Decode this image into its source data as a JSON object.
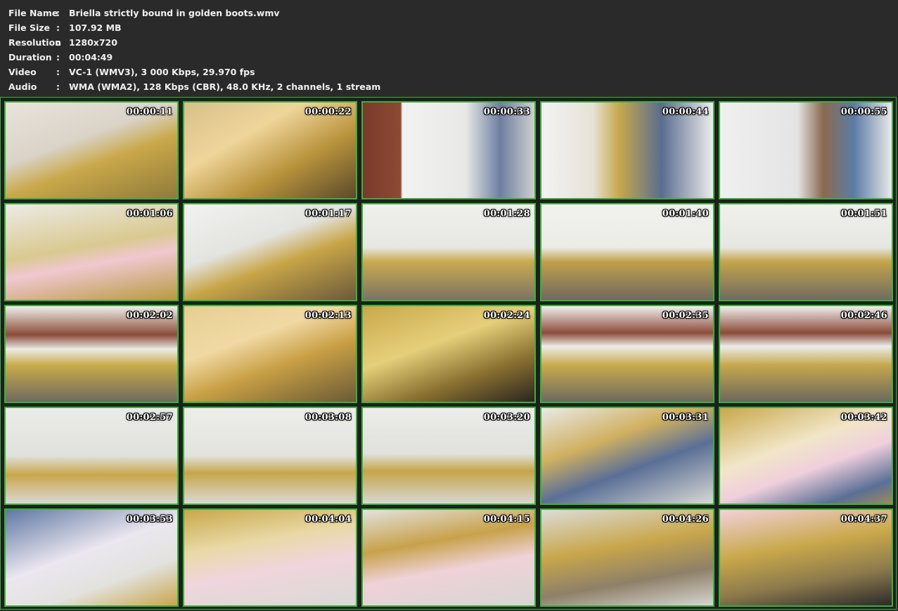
{
  "info": [
    {
      "key": "File Name",
      "value": "Briella strictly bound in golden boots.wmv"
    },
    {
      "key": "File Size",
      "value": "107.92 MB"
    },
    {
      "key": "Resolution",
      "value": "1280x720"
    },
    {
      "key": "Duration",
      "value": "00:04:49"
    },
    {
      "key": "Video",
      "value": "VC-1 (WMV3), 3 000 Kbps, 29.970 fps"
    },
    {
      "key": "Audio",
      "value": "WMA (WMA2), 128 Kbps (CBR), 48.0 KHz, 2 channels, 1 stream"
    }
  ],
  "separator": ":",
  "colors": {
    "background": "#2a2a2a",
    "frame_border": "#37b237",
    "text": "#f0f0f0"
  },
  "thumbnails": [
    {
      "time": "00:00:11"
    },
    {
      "time": "00:00:22"
    },
    {
      "time": "00:00:33"
    },
    {
      "time": "00:00:44"
    },
    {
      "time": "00:00:55"
    },
    {
      "time": "00:01:06"
    },
    {
      "time": "00:01:17"
    },
    {
      "time": "00:01:28"
    },
    {
      "time": "00:01:40"
    },
    {
      "time": "00:01:51"
    },
    {
      "time": "00:02:02"
    },
    {
      "time": "00:02:13"
    },
    {
      "time": "00:02:24"
    },
    {
      "time": "00:02:35"
    },
    {
      "time": "00:02:46"
    },
    {
      "time": "00:02:57"
    },
    {
      "time": "00:03:08"
    },
    {
      "time": "00:03:20"
    },
    {
      "time": "00:03:31"
    },
    {
      "time": "00:03:42"
    },
    {
      "time": "00:03:53"
    },
    {
      "time": "00:04:04"
    },
    {
      "time": "00:04:15"
    },
    {
      "time": "00:04:26"
    },
    {
      "time": "00:04:37"
    }
  ]
}
